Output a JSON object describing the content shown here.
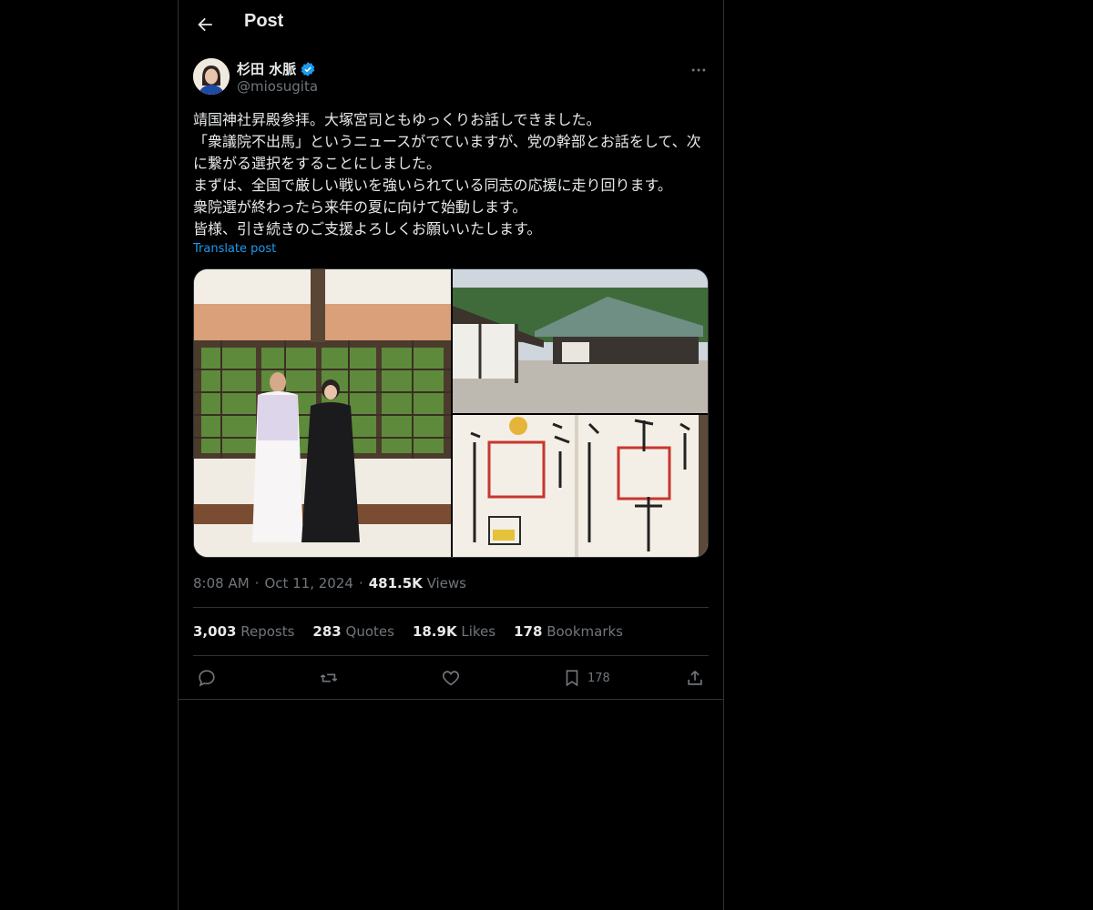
{
  "header": {
    "title": "Post"
  },
  "post": {
    "display_name": "杉田 水脈",
    "handle": "@miosugita",
    "text": "靖国神社昇殿参拝。大塚宮司ともゆっくりお話しできました。\n「衆議院不出馬」というニュースがでていますが、党の幹部とお話をして、次に繋がる選択をすることにしました。\nまずは、全国で厳しい戦いを強いられている同志の応援に走り回ります。\n衆院選が終わったら来年の夏に向けて始動します。\n皆様、引き続きのご支援よろしくお願いいたします。",
    "translate_label": "Translate post",
    "time": "8:08 AM",
    "date": "Oct 11, 2024",
    "views_count": "481.5K",
    "views_label": "Views"
  },
  "stats": {
    "reposts_count": "3,003",
    "reposts_label": "Reposts",
    "quotes_count": "283",
    "quotes_label": "Quotes",
    "likes_count": "18.9K",
    "likes_label": "Likes",
    "bookmarks_count": "178",
    "bookmarks_label": "Bookmarks"
  },
  "actions": {
    "bookmark_count": "178"
  },
  "colors": {
    "background": "#000000",
    "text": "#e7e9ea",
    "muted": "#71767b",
    "accent": "#1d9bf0",
    "border": "#2f3336"
  }
}
